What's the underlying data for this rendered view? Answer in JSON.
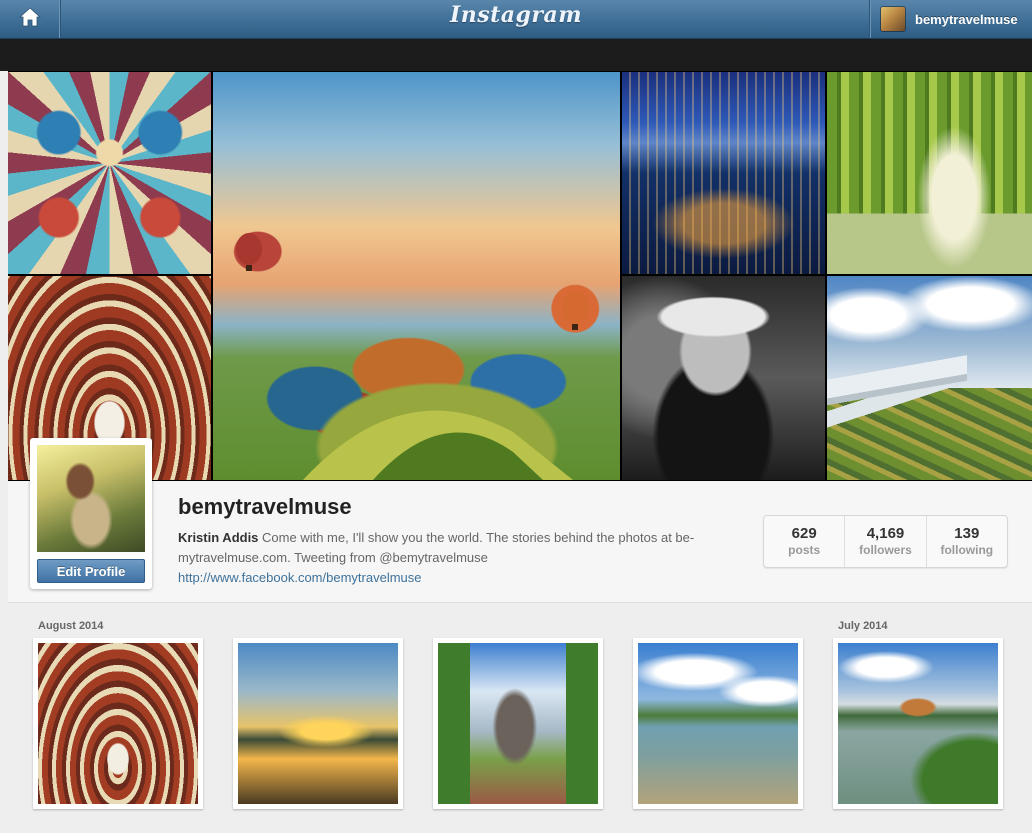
{
  "header": {
    "logo": "Instagram",
    "username": "bemytravelmuse"
  },
  "cover": {
    "tiles": [
      "mosaic-ceiling",
      "brick-arches",
      "balloon-festival",
      "city-night",
      "green-arbor",
      "woman-portrait",
      "airplane-wing"
    ]
  },
  "profile": {
    "username": "bemytravelmuse",
    "full_name": "Kristin Addis",
    "bio": " Come with me, I'll show you the world. The stories behind the photos at be-mytravelmuse.com. Tweeting from @bemytravelmuse",
    "website": "http://www.facebook.com/bemytravelmuse",
    "edit_label": "Edit Profile",
    "stats": [
      {
        "value": "629",
        "label": "posts"
      },
      {
        "value": "4,169",
        "label": "followers"
      },
      {
        "value": "139",
        "label": "following"
      }
    ]
  },
  "feed": {
    "months": [
      "August 2014",
      "July 2014"
    ],
    "photos": [
      "arches",
      "sunset-river",
      "sculpture-plaza",
      "lake-shore",
      "castle-lake"
    ]
  },
  "colors": {
    "header": "#3f6f97",
    "link": "#3f729b",
    "button": "#4f80b0"
  },
  "icons": {
    "home": "home-icon"
  }
}
